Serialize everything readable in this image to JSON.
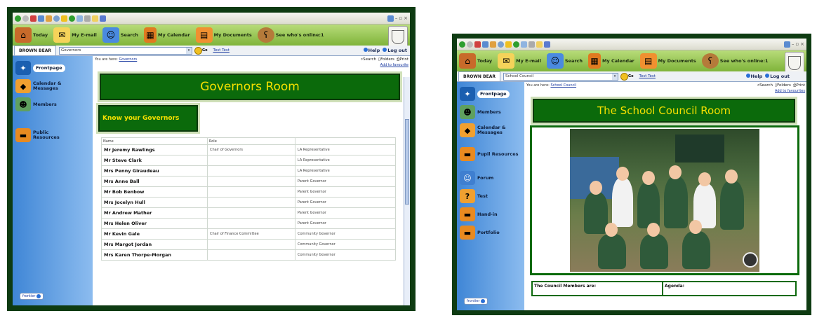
{
  "left": {
    "app_buttons": [
      {
        "label": "Today",
        "icon": "house-icon"
      },
      {
        "label": "My E-mail",
        "icon": "mail-icon"
      },
      {
        "label": "Search",
        "icon": "people-search-icon"
      },
      {
        "label": "My Calendar",
        "icon": "calendar-icon"
      },
      {
        "label": "My Documents",
        "icon": "documents-icon"
      },
      {
        "label": "See who's online:1",
        "icon": "bear-icon"
      }
    ],
    "user_tab": "BROWN BEAR",
    "room_select": "Governors",
    "go_label": "Go",
    "user_link": "Test Test",
    "help": "Help",
    "logout": "Log out",
    "sidebar": [
      {
        "label": "Frontpage",
        "icon": "frontpage-icon"
      },
      {
        "label": "Calendar & Messages",
        "icon": "calendar-cube-icon"
      },
      {
        "label": "Members",
        "icon": "members-icon"
      },
      {
        "label": "Public Resources",
        "icon": "folder-icon"
      }
    ],
    "frontier": "frontier",
    "breadcrumb_prefix": "You are here:",
    "breadcrumb_link": "Governors",
    "tools": [
      "Search",
      "Folders",
      "Print"
    ],
    "add_fav": "Add to favourite",
    "page_title": "Governors Room",
    "section_title": "Know your Governors",
    "table": {
      "headers": [
        "Name",
        "Role",
        ""
      ],
      "rows": [
        [
          "Mr Jeremy Rawlings",
          "Chair of Governors",
          "LA Representative"
        ],
        [
          "Mr Steve Clark",
          "",
          "LA Representative"
        ],
        [
          "Mrs Penny Giraudeau",
          "",
          "LA Representative"
        ],
        [
          "Mrs Anne Ball",
          "",
          "Parent Governor"
        ],
        [
          "Mr Bob Benbow",
          "",
          "Parent Governor"
        ],
        [
          "Mrs Jocelyn Hull",
          "",
          "Parent Governor"
        ],
        [
          "Mr Andrew Mather",
          "",
          "Parent Governor"
        ],
        [
          "Mrs Helen Oliver",
          "",
          "Parent Governor"
        ],
        [
          "Mr Kevin Gale",
          "Chair of Finance Committee",
          "Community Governor"
        ],
        [
          "Mrs Margot Jordan",
          "",
          "Community Governor"
        ],
        [
          "Mrs Karen Thorpe-Morgan",
          "",
          "Community Governor"
        ]
      ]
    }
  },
  "right": {
    "app_buttons": [
      {
        "label": "Today",
        "icon": "house-icon"
      },
      {
        "label": "My E-mail",
        "icon": "mail-icon"
      },
      {
        "label": "Search",
        "icon": "people-search-icon"
      },
      {
        "label": "My Calendar",
        "icon": "calendar-icon"
      },
      {
        "label": "My Documents",
        "icon": "documents-icon"
      },
      {
        "label": "See who's online:1",
        "icon": "bear-icon"
      }
    ],
    "user_tab": "BROWN BEAR",
    "room_select": "School Council",
    "go_label": "Go",
    "user_link": "Test Test",
    "help": "Help",
    "logout": "Log out",
    "sidebar": [
      {
        "label": "Frontpage",
        "icon": "frontpage-icon"
      },
      {
        "label": "Members",
        "icon": "members-icon"
      },
      {
        "label": "Calendar & Messages",
        "icon": "calendar-cube-icon"
      },
      {
        "label": "Pupil Resources",
        "icon": "folder-icon"
      },
      {
        "label": "Forum",
        "icon": "forum-icon"
      },
      {
        "label": "Test",
        "icon": "question-icon"
      },
      {
        "label": "Hand-in",
        "icon": "handin-icon"
      },
      {
        "label": "Portfolio",
        "icon": "portfolio-icon"
      }
    ],
    "frontier": "frontier",
    "breadcrumb_prefix": "You are here:",
    "breadcrumb_link": "School Council",
    "tools": [
      "Search",
      "Folders",
      "Print"
    ],
    "add_fav": "Add to favourites",
    "page_title": "The School Council Room",
    "council_members": "The Council Members are:",
    "agenda": "Agenda:"
  },
  "colors": {
    "frame": "#0e3b12",
    "banner": "#0b6a0b",
    "banner_text": "#f5e000",
    "appbar": "#8fc24a",
    "sidebar": "#5a9be0"
  }
}
